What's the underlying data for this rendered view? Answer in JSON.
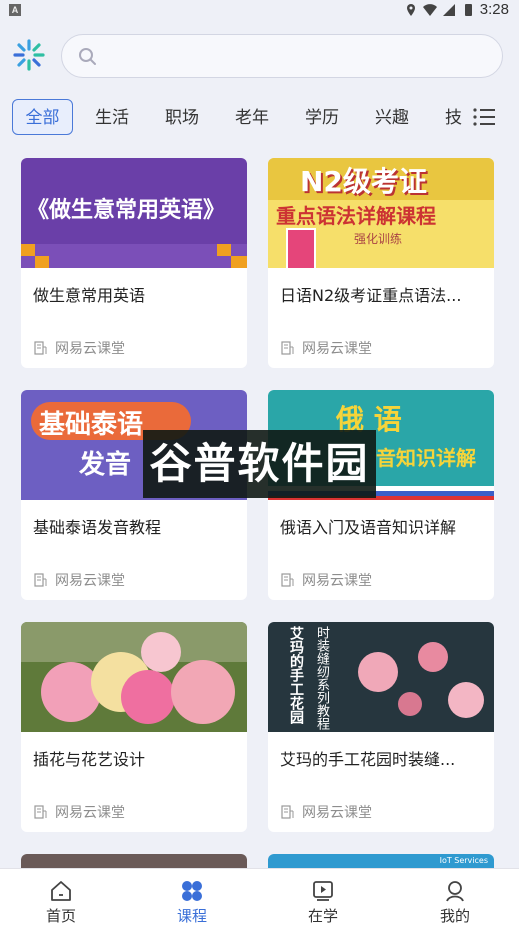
{
  "status_bar": {
    "time": "3:28",
    "app_icon_letter": "A"
  },
  "search": {
    "placeholder": ""
  },
  "tabs": [
    {
      "label": "全部",
      "active": true
    },
    {
      "label": "生活"
    },
    {
      "label": "职场"
    },
    {
      "label": "老年"
    },
    {
      "label": "学历"
    },
    {
      "label": "兴趣"
    },
    {
      "label": "技"
    }
  ],
  "courses": [
    {
      "title": "做生意常用英语",
      "source": "网易云课堂",
      "thumb_text": "《做生意常用英语》"
    },
    {
      "title": "日语N2级考证重点语法...",
      "source": "网易云课堂",
      "thumb_text_1": "N2级考证",
      "thumb_text_2": "重点语法详解课程",
      "thumb_text_3": "强化训练"
    },
    {
      "title": "基础泰语发音教程",
      "source": "网易云课堂",
      "thumb_text_1": "基础泰语",
      "thumb_text_2": "发音"
    },
    {
      "title": "俄语入门及语音知识详解",
      "source": "网易云课堂",
      "thumb_text_1": "俄 语",
      "thumb_text_2": "音知识详解"
    },
    {
      "title": "插花与花艺设计",
      "source": "网易云课堂"
    },
    {
      "title": "艾玛的手工花园时装缝...",
      "source": "网易云课堂",
      "thumb_text_1": "艾玛的手工花园",
      "thumb_text_2": "时装缝纫系列教程"
    }
  ],
  "partial_row": {
    "thumb_text_right": "IoT Services"
  },
  "watermark": "谷普软件园",
  "bottom_nav": [
    {
      "label": "首页",
      "icon": "home-icon"
    },
    {
      "label": "课程",
      "icon": "course-grid-icon",
      "active": true
    },
    {
      "label": "在学",
      "icon": "play-video-icon"
    },
    {
      "label": "我的",
      "icon": "profile-icon"
    }
  ],
  "colors": {
    "accent": "#3a6fd8",
    "background": "#eef0f7"
  }
}
